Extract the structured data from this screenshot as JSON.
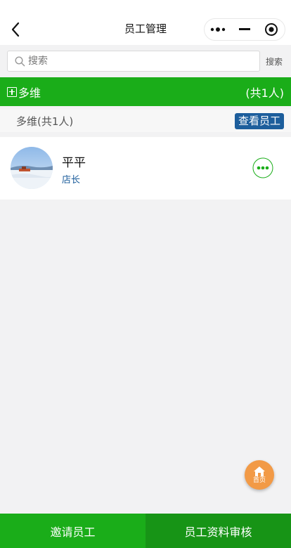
{
  "navbar": {
    "title": "员工管理",
    "back_icon": "chevron-left-icon",
    "menu_icon": "more-dots-icon",
    "minimize_icon": "minimize-icon",
    "close_icon": "target-icon"
  },
  "search": {
    "placeholder": "搜索",
    "value": "",
    "button_label": "搜索"
  },
  "group": {
    "name": "多维",
    "count_label": "(共1人)",
    "header_color": "#1aad19"
  },
  "subgroup": {
    "label": "多维(共1人)",
    "view_button_label": "查看员工",
    "view_button_color": "#1d5e9c"
  },
  "members": [
    {
      "name": "平平",
      "role": "店长"
    }
  ],
  "fab": {
    "label": "首页",
    "icon": "home-icon",
    "color": "#f29a46"
  },
  "bottom_bar": {
    "left_label": "邀请员工",
    "right_label": "员工资料审核"
  }
}
